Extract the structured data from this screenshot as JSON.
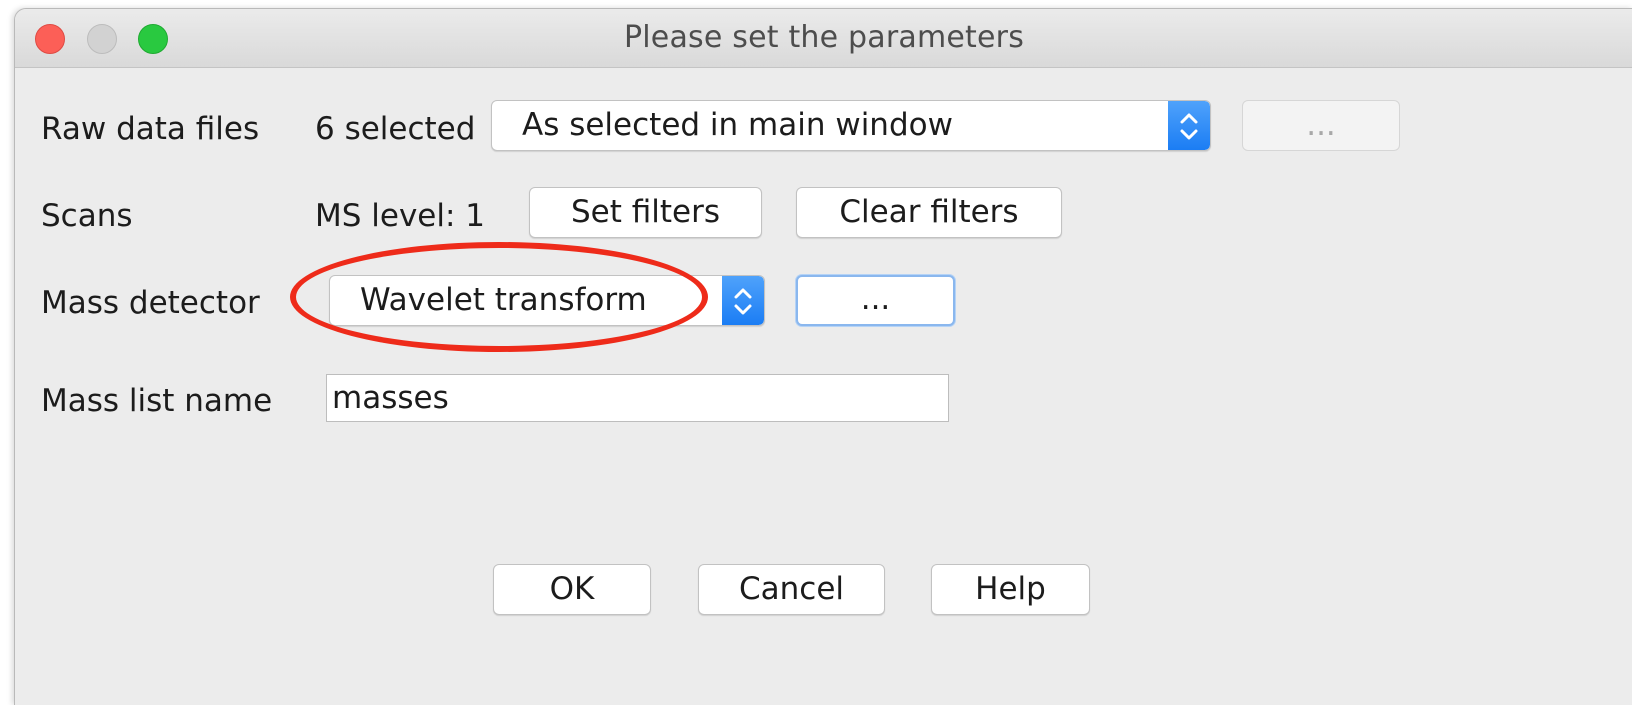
{
  "window": {
    "title": "Please set the parameters"
  },
  "raw_data_files": {
    "label": "Raw data files",
    "count_text": "6 selected",
    "selection": "As selected in main window",
    "more_button": "..."
  },
  "scans": {
    "label": "Scans",
    "ms_level_text": "MS level: 1",
    "set_filters_button": "Set filters",
    "clear_filters_button": "Clear filters"
  },
  "mass_detector": {
    "label": "Mass detector",
    "selection": "Wavelet transform",
    "setup_button": "..."
  },
  "mass_list_name": {
    "label": "Mass list name",
    "value": "masses"
  },
  "footer": {
    "ok_button": "OK",
    "cancel_button": "Cancel",
    "help_button": "Help"
  },
  "colors": {
    "annotation_ellipse": "#ee2b1a",
    "select_accent": "#1b7df4",
    "window_background": "#ececec"
  },
  "icons": {
    "close": "close-button-red-circle",
    "minimize": "minimize-button-gray-circle",
    "maximize": "maximize-button-green-circle",
    "select_arrows": "chevron-up-down-icon"
  }
}
